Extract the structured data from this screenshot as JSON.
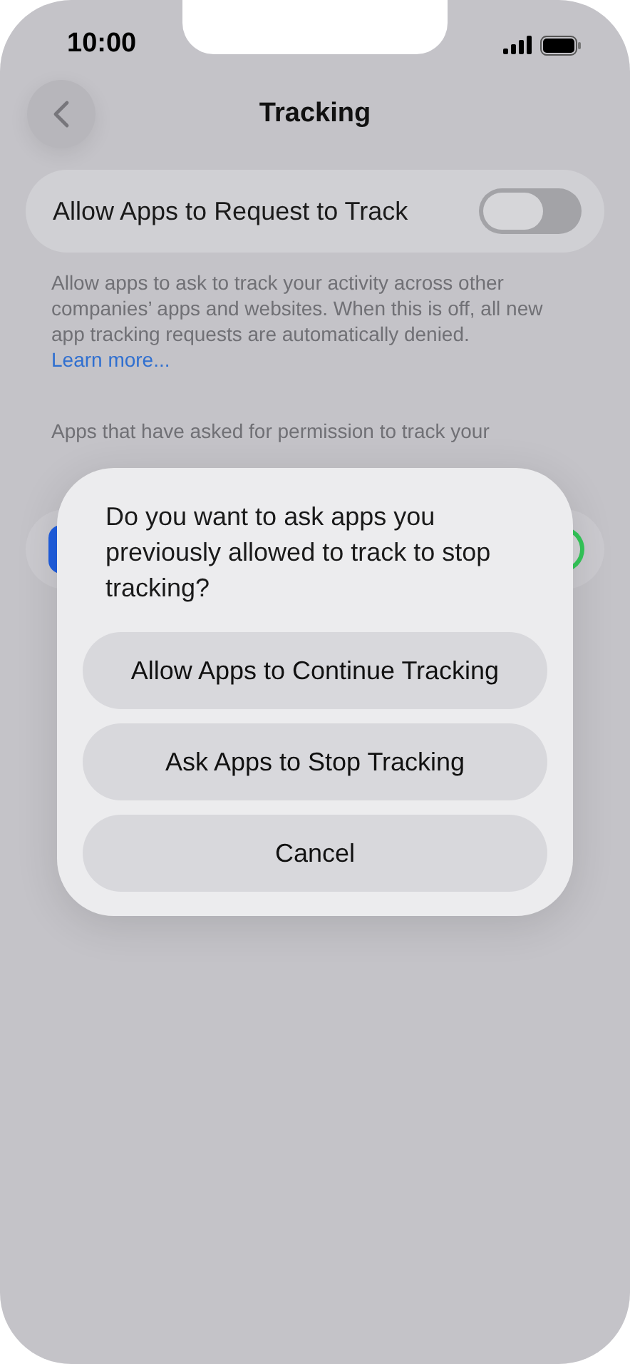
{
  "status_bar": {
    "time": "10:00"
  },
  "nav": {
    "title": "Tracking"
  },
  "setting": {
    "label": "Allow Apps to Request to Track",
    "on": false
  },
  "description": {
    "text": "Allow apps to ask to track your activity across other companies’ apps and websites. When this is off, all new app tracking requests are automatically denied.",
    "link": "Learn more..."
  },
  "section_note": "Apps that have asked for permission to track your",
  "app_rows": [
    {
      "on": true
    }
  ],
  "dialog": {
    "message": "Do you want to ask apps you previously allowed to track to stop tracking?",
    "buttons": [
      "Allow Apps to Continue Tracking",
      "Ask Apps to Stop Tracking",
      "Cancel"
    ]
  }
}
